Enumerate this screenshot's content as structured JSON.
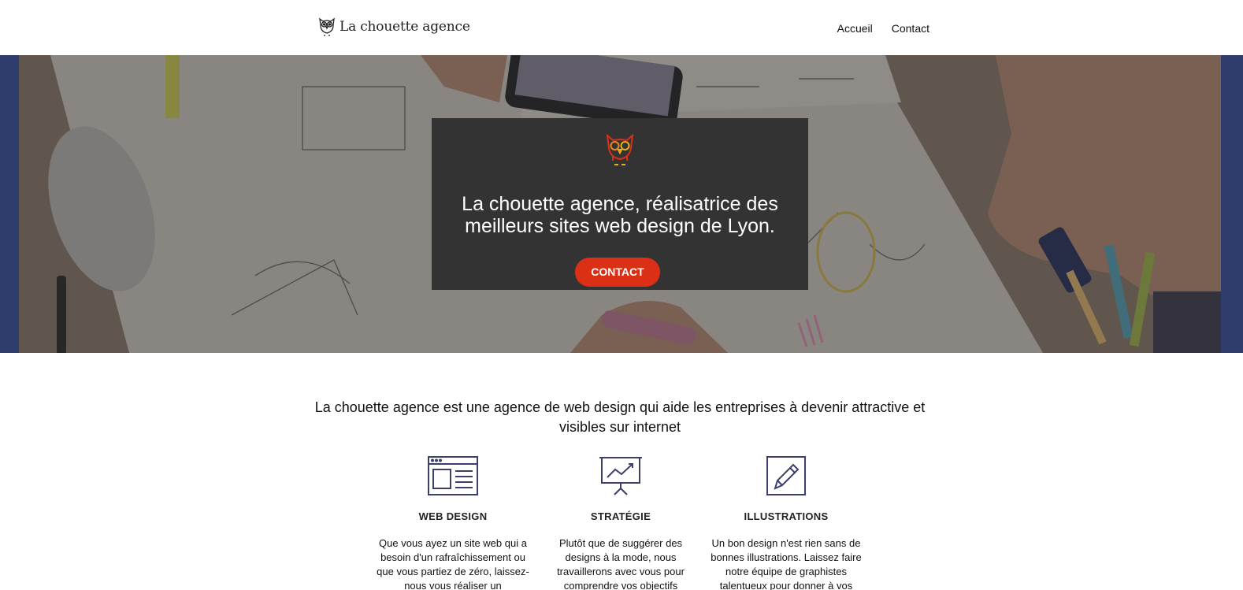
{
  "header": {
    "logo_text": "La chouette agence",
    "logo_icon": "owl-icon",
    "nav": [
      {
        "label": "Accueil"
      },
      {
        "label": "Contact"
      }
    ]
  },
  "hero": {
    "owl_icon": "owl-logo-icon",
    "title": "La chouette agence, réalisatrice des meilleurs sites web design de Lyon.",
    "button_label": "CONTACT",
    "button_color": "#dc3016",
    "card_color": "#333333"
  },
  "intro": {
    "text": "La chouette agence est une agence de web design qui aide les entreprises à devenir attractive et visibles sur internet"
  },
  "services": [
    {
      "icon": "web-design-icon",
      "title": "WEB DESIGN",
      "text": "Que vous ayez un site web qui a besoin d'un rafraîchissement ou que vous partiez de zéro, laissez-nous vous réaliser un"
    },
    {
      "icon": "strategy-presentation-icon",
      "title": "STRATÉGIE",
      "text": "Plutôt que de suggérer des designs à la mode, nous travaillerons avec vous pour comprendre vos objectifs"
    },
    {
      "icon": "pencil-illustration-icon",
      "title": "ILLUSTRATIONS",
      "text": "Un bon design n'est rien sans de bonnes illustrations. Laissez faire notre équipe de graphistes talentueux pour donner à vos"
    }
  ],
  "colors": {
    "icon_stroke": "#3c3f6b",
    "hero_side": "#2f3d6d"
  }
}
